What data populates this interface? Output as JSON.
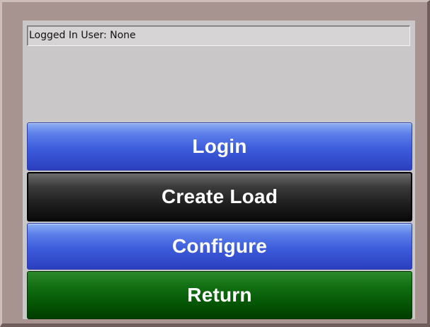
{
  "status": {
    "logged_in_user_text": "Logged In User: None"
  },
  "buttons": {
    "login": "Login",
    "create_load": "Create Load",
    "configure": "Configure",
    "return": "Return"
  },
  "colors": {
    "bezel": "#a79491",
    "screen_background": "#c9c7c8",
    "login_button": "#3c5cdc",
    "create_load_button": "#1e1e1e",
    "configure_button": "#3c5cdc",
    "return_button": "#055805"
  }
}
